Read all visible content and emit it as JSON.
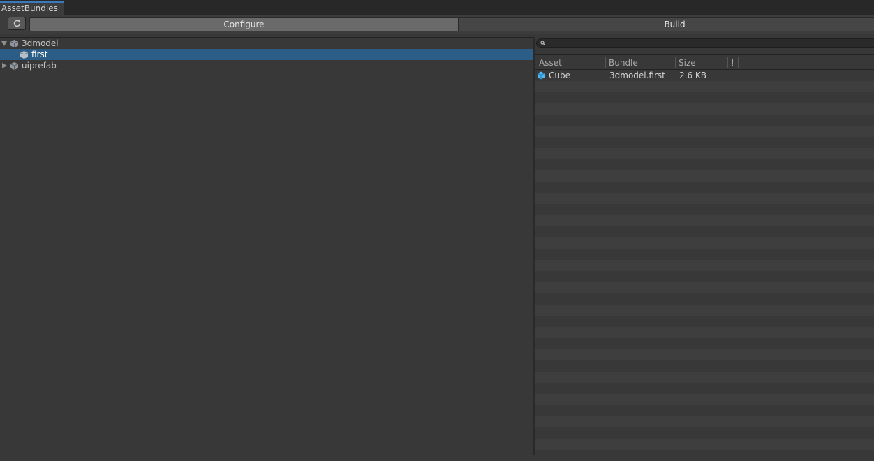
{
  "window": {
    "tab_title": "AssetBundles"
  },
  "toolbar": {
    "configure_label": "Configure",
    "build_label": "Build"
  },
  "tree": {
    "items": [
      {
        "label": "3dmodel",
        "expanded": true,
        "selected": false,
        "depth": 0
      },
      {
        "label": "first",
        "selected": true,
        "depth": 1
      },
      {
        "label": "uiprefab",
        "expanded": false,
        "selected": false,
        "depth": 0
      }
    ]
  },
  "search": {
    "value": "",
    "placeholder": ""
  },
  "table": {
    "columns": [
      "Asset",
      "Bundle",
      "Size",
      "!"
    ],
    "rows": [
      {
        "asset": "Cube",
        "bundle": "3dmodel.first",
        "size": "2.6 KB"
      }
    ]
  },
  "colors": {
    "accent": "#3a79bb",
    "selection": "#2c5d87",
    "panel_bg": "#383838",
    "row_alt": "#3e3e3e",
    "asset_icon": "#4fb6f0"
  }
}
